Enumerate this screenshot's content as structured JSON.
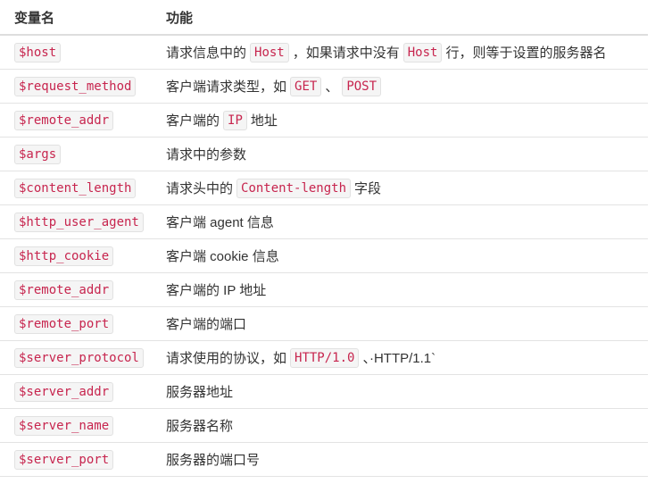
{
  "header": {
    "col1": "变量名",
    "col2": "功能"
  },
  "rows": [
    {
      "var": "$host",
      "desc": [
        {
          "t": "text",
          "v": "请求信息中的"
        },
        {
          "t": "code",
          "v": "Host"
        },
        {
          "t": "text",
          "v": "，如果请求中没有"
        },
        {
          "t": "code",
          "v": "Host"
        },
        {
          "t": "text",
          "v": "行，则等于设置的服务器名"
        }
      ]
    },
    {
      "var": "$request_method",
      "desc": [
        {
          "t": "text",
          "v": "客户端请求类型，如"
        },
        {
          "t": "code",
          "v": "GET"
        },
        {
          "t": "text",
          "v": "、"
        },
        {
          "t": "code",
          "v": "POST"
        }
      ]
    },
    {
      "var": "$remote_addr",
      "desc": [
        {
          "t": "text",
          "v": "客户端的"
        },
        {
          "t": "code",
          "v": "IP"
        },
        {
          "t": "text",
          "v": "地址"
        }
      ]
    },
    {
      "var": "$args",
      "desc": [
        {
          "t": "text",
          "v": "请求中的参数"
        }
      ]
    },
    {
      "var": "$content_length",
      "desc": [
        {
          "t": "text",
          "v": "请求头中的"
        },
        {
          "t": "code",
          "v": "Content-length"
        },
        {
          "t": "text",
          "v": "字段"
        }
      ]
    },
    {
      "var": "$http_user_agent",
      "desc": [
        {
          "t": "text",
          "v": "客户端 agent 信息"
        }
      ]
    },
    {
      "var": "$http_cookie",
      "desc": [
        {
          "t": "text",
          "v": "客户端 cookie 信息"
        }
      ]
    },
    {
      "var": "$remote_addr",
      "desc": [
        {
          "t": "text",
          "v": "客户端的 IP 地址"
        }
      ]
    },
    {
      "var": "$remote_port",
      "desc": [
        {
          "t": "text",
          "v": "客户端的端口"
        }
      ]
    },
    {
      "var": "$server_protocol",
      "desc": [
        {
          "t": "text",
          "v": "请求使用的协议，如"
        },
        {
          "t": "code",
          "v": "HTTP/1.0"
        },
        {
          "t": "text",
          "v": "、·HTTP/1.1`"
        }
      ]
    },
    {
      "var": "$server_addr",
      "desc": [
        {
          "t": "text",
          "v": "服务器地址"
        }
      ]
    },
    {
      "var": "$server_name",
      "desc": [
        {
          "t": "text",
          "v": "服务器名称"
        }
      ]
    },
    {
      "var": "$server_port",
      "desc": [
        {
          "t": "text",
          "v": "服务器的端口号"
        }
      ]
    }
  ]
}
